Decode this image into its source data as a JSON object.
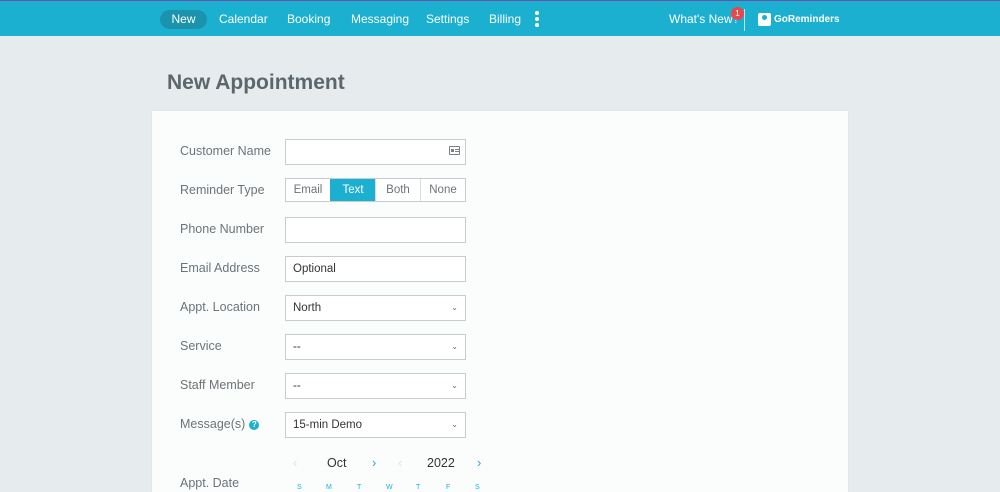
{
  "nav": {
    "items": [
      "New",
      "Calendar",
      "Booking",
      "Messaging",
      "Settings",
      "Billing"
    ],
    "whats_new": "What's New?",
    "badge_count": "1",
    "brand": "GoReminders"
  },
  "page": {
    "title": "New Appointment"
  },
  "form": {
    "customer_name_label": "Customer Name",
    "customer_name_value": "",
    "reminder_type_label": "Reminder Type",
    "reminder_options": [
      "Email",
      "Text",
      "Both",
      "None"
    ],
    "reminder_selected": "Text",
    "phone_label": "Phone Number",
    "phone_value": "",
    "email_label": "Email Address",
    "email_placeholder": "Optional",
    "location_label": "Appt. Location",
    "location_value": "North",
    "service_label": "Service",
    "service_value": "--",
    "staff_label": "Staff Member",
    "staff_value": "--",
    "messages_label": "Message(s)",
    "messages_value": "15-min Demo",
    "date_label": "Appt. Date"
  },
  "calendar": {
    "month": "Oct",
    "year": "2022",
    "weekdays": [
      "S",
      "M",
      "T",
      "W",
      "T",
      "F",
      "S"
    ]
  },
  "colors": {
    "accent": "#1cb0d0",
    "badge": "#e8474c",
    "background": "#e6ecee"
  }
}
